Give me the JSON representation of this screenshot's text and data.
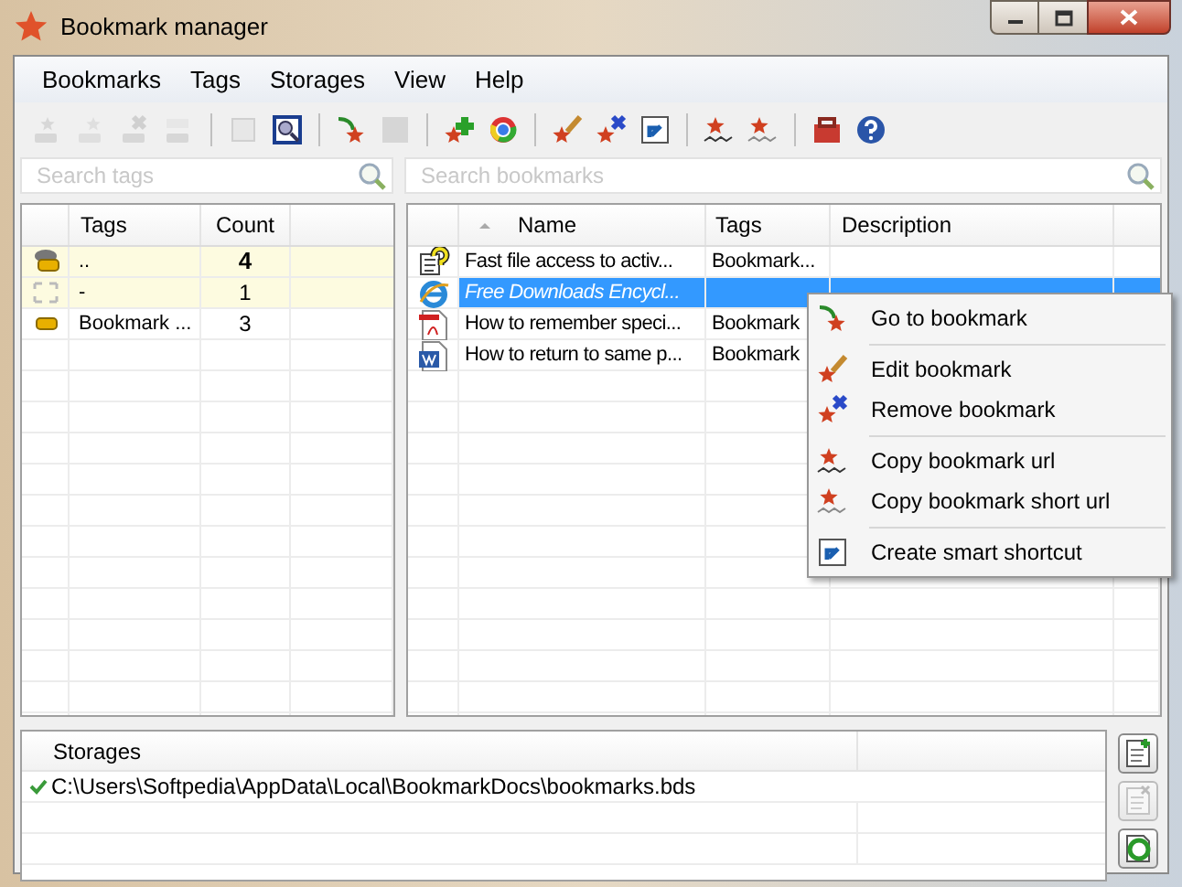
{
  "window": {
    "title": "Bookmark manager"
  },
  "menu": [
    "Bookmarks",
    "Tags",
    "Storages",
    "View",
    "Help"
  ],
  "toolbar": [
    {
      "kind": "button",
      "disabled": true
    },
    {
      "kind": "button",
      "disabled": true
    },
    {
      "kind": "button",
      "disabled": true
    },
    {
      "kind": "button",
      "disabled": true
    },
    {
      "kind": "separator"
    },
    {
      "kind": "button",
      "disabled": true
    },
    {
      "kind": "button",
      "disabled": false
    },
    {
      "kind": "separator"
    },
    {
      "kind": "button",
      "disabled": false
    },
    {
      "kind": "button",
      "disabled": true
    },
    {
      "kind": "separator"
    },
    {
      "kind": "button",
      "disabled": false
    },
    {
      "kind": "button",
      "disabled": false
    },
    {
      "kind": "separator"
    },
    {
      "kind": "button",
      "disabled": false
    },
    {
      "kind": "button",
      "disabled": false
    },
    {
      "kind": "button",
      "disabled": false
    },
    {
      "kind": "separator"
    },
    {
      "kind": "button",
      "disabled": false
    },
    {
      "kind": "button",
      "disabled": false
    },
    {
      "kind": "separator"
    },
    {
      "kind": "button",
      "disabled": false
    },
    {
      "kind": "button",
      "disabled": false
    }
  ],
  "tag_search": {
    "placeholder": "Search tags"
  },
  "bookmark_search": {
    "placeholder": "Search bookmarks"
  },
  "tags_table": {
    "columns": [
      "Tags",
      "Count"
    ],
    "rows": [
      {
        "tag": "..",
        "count": "4",
        "highlighted": true,
        "bold": true
      },
      {
        "tag": "-",
        "count": "1",
        "highlighted": true,
        "bold": false
      },
      {
        "tag": "Bookmark ...",
        "count": "3",
        "highlighted": false,
        "bold": false
      }
    ]
  },
  "bookmarks_table": {
    "columns": [
      "Name",
      "Tags",
      "Description"
    ],
    "rows": [
      {
        "name": "Fast file access to activ...",
        "tags": "Bookmark...",
        "selected": false
      },
      {
        "name": "Free Downloads Encycl...",
        "selected": true
      },
      {
        "name": "How to remember speci...",
        "tags": "Bookmark",
        "selected": false
      },
      {
        "name": "How to return to same p...",
        "tags": "Bookmark",
        "selected": false
      }
    ]
  },
  "context_menu": [
    {
      "kind": "item",
      "label": "Go to bookmark"
    },
    {
      "kind": "separator"
    },
    {
      "kind": "item",
      "label": "Edit bookmark"
    },
    {
      "kind": "item",
      "label": "Remove bookmark"
    },
    {
      "kind": "separator"
    },
    {
      "kind": "item",
      "label": "Copy bookmark url"
    },
    {
      "kind": "item",
      "label": "Copy bookmark short url"
    },
    {
      "kind": "separator"
    },
    {
      "kind": "item",
      "label": "Create smart shortcut"
    }
  ],
  "storages": {
    "column": "Storages",
    "rows": [
      {
        "path": "C:\\Users\\Softpedia\\AppData\\Local\\BookmarkDocs\\bookmarks.bds",
        "checked": true
      }
    ],
    "buttons": [
      {
        "disabled": false
      },
      {
        "disabled": true
      },
      {
        "disabled": false
      }
    ]
  }
}
